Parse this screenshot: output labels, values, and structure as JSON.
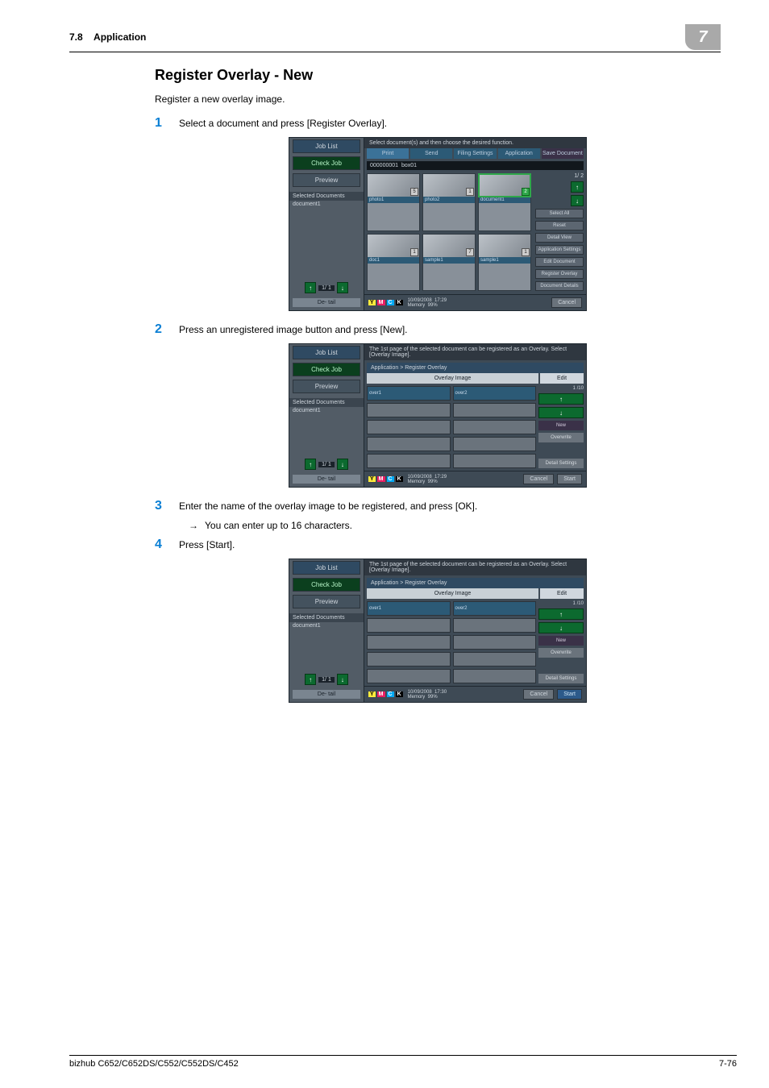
{
  "header": {
    "section": "7.8",
    "title": "Application",
    "chapter": "7"
  },
  "body": {
    "title": "Register Overlay - New",
    "intro": "Register a new overlay image."
  },
  "steps": [
    {
      "num": "1",
      "text": "Select a document and press [Register Overlay]."
    },
    {
      "num": "2",
      "text": "Press an unregistered image button and press [New]."
    },
    {
      "num": "3",
      "text": "Enter the name of the overlay image to be registered, and press [OK].",
      "sub": "You can enter up to 16 characters."
    },
    {
      "num": "4",
      "text": "Press [Start]."
    }
  ],
  "s1": {
    "msg": "Select document(s) and then choose the desired function.",
    "left": {
      "jobList": "Job List",
      "checkJob": "Check Job",
      "preview": "Preview",
      "selDocs": "Selected Documents",
      "doc": "document1",
      "page": "1/  1",
      "detail": "De-\ntail"
    },
    "tabs": [
      "Print",
      "Send",
      "Filing Settings",
      "Application",
      "Save Document"
    ],
    "boxId": "000000001",
    "boxName": "box01",
    "thumbs": [
      {
        "lbl": "photo1",
        "cnt": "5"
      },
      {
        "lbl": "photo2",
        "cnt": "1"
      },
      {
        "lbl": "document1",
        "cnt": "2"
      },
      {
        "lbl": "doc1",
        "cnt": "1"
      },
      {
        "lbl": "sample1",
        "cnt": "7"
      },
      {
        "lbl": "sample1",
        "cnt": "1"
      }
    ],
    "gridPage": "1/  2",
    "side": [
      "Select All",
      "Reset",
      "Detail View"
    ],
    "rside": [
      "Application Settings",
      "Edit Document",
      "Register Overlay",
      "Document Details"
    ],
    "footer": {
      "date": "10/09/2008",
      "time": "17:29",
      "memLbl": "Memory",
      "mem": "99%",
      "cancel": "Cancel"
    }
  },
  "s2": {
    "msg": "The 1st page of the selected document can be registered as an Overlay.  Select [Overlay Image].",
    "breadcrumb": "Application > Register Overlay",
    "ovHeader": "Overlay Image",
    "edit": "Edit",
    "slots": [
      "over1",
      "over2"
    ],
    "page": "1  /10",
    "btns": [
      "New",
      "Overwrite",
      "Detail Settings"
    ],
    "footer": {
      "cancel": "Cancel",
      "start": "Start"
    }
  },
  "s3": {
    "footer": {
      "time": "17:30"
    }
  },
  "footer": {
    "model": "bizhub C652/C652DS/C552/C552DS/C452",
    "page": "7-76"
  }
}
